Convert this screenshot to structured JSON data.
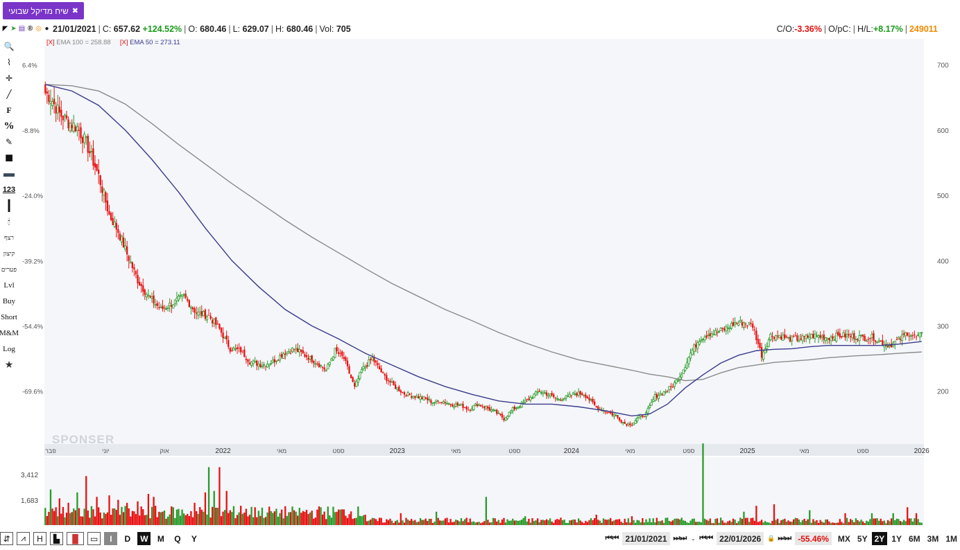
{
  "tab": {
    "label": "שיח מדיקל שבועי",
    "close": "✖"
  },
  "info": {
    "date": "21/01/2021",
    "close_label": "C:",
    "close_value": "657.62",
    "change": "+124.52%",
    "open_label": "O:",
    "open_value": "680.46",
    "low_label": "L:",
    "low_value": "629.07",
    "high_label": "H:",
    "high_value": "680.46",
    "vol_label": "Vol:",
    "vol_value": "705",
    "co_label": "C/O:",
    "co_value": "-3.36%",
    "opc_label": "O/pC:",
    "hl_label": "H/L:",
    "hl_value": "+8.17%",
    "security_id": "249011"
  },
  "legend": {
    "ema100": "EMA 100 = 258.88",
    "ema50": "EMA 50 = 273.11",
    "remove": "[X]"
  },
  "toolbar": [
    "🔍",
    "⌇",
    "✛",
    "╱",
    "F",
    "%",
    "✎",
    "■",
    "▬",
    "123",
    "┃",
    "🕯",
    "רצף",
    "קיצון",
    "פערים",
    "Lvl",
    "Buy",
    "Short",
    "M&M",
    "Log",
    "★"
  ],
  "watermark": "SPONSER",
  "colors": {
    "up": "#2a9a2a",
    "down": "#e81010",
    "ema50": "#3a3a8c",
    "ema100": "#8a8a8a"
  },
  "chart_data": {
    "type": "candlestick",
    "x_tick_labels": [
      "פבר",
      "יוני",
      "אוק",
      "2022",
      "מאי",
      "ספט",
      "2023",
      "מאי",
      "ספט",
      "2024",
      "מאי",
      "ספט",
      "2025",
      "מאי",
      "ספט",
      "2026"
    ],
    "y_right_ticks": [
      "700",
      "600",
      "500",
      "400",
      "300",
      "200"
    ],
    "y_left_ticks": [
      "6.4%",
      "-8.8%",
      "-24.0%",
      "-39.2%",
      "-54.4%",
      "-69.6%"
    ],
    "volume_ticks": [
      "3,412",
      "1,683"
    ],
    "ylim": [
      120,
      740
    ],
    "price_path": [
      [
        0,
        657
      ],
      [
        3,
        650
      ],
      [
        8,
        625
      ],
      [
        13,
        612
      ],
      [
        18,
        604
      ],
      [
        23,
        580
      ],
      [
        30,
        530
      ],
      [
        36,
        470
      ],
      [
        41,
        445
      ],
      [
        46,
        410
      ],
      [
        52,
        370
      ],
      [
        58,
        345
      ],
      [
        65,
        325
      ],
      [
        72,
        335
      ],
      [
        78,
        345
      ],
      [
        85,
        320
      ],
      [
        92,
        315
      ],
      [
        98,
        295
      ],
      [
        104,
        265
      ],
      [
        110,
        262
      ],
      [
        115,
        245
      ],
      [
        122,
        240
      ],
      [
        128,
        245
      ],
      [
        134,
        258
      ],
      [
        140,
        265
      ],
      [
        146,
        255
      ],
      [
        152,
        245
      ],
      [
        158,
        232
      ],
      [
        163,
        262
      ],
      [
        168,
        250
      ],
      [
        174,
        205
      ],
      [
        178,
        232
      ],
      [
        184,
        250
      ],
      [
        190,
        225
      ],
      [
        196,
        208
      ],
      [
        202,
        196
      ],
      [
        208,
        192
      ],
      [
        214,
        188
      ],
      [
        218,
        183
      ],
      [
        223,
        185
      ],
      [
        228,
        180
      ],
      [
        234,
        178
      ],
      [
        238,
        172
      ],
      [
        243,
        180
      ],
      [
        248,
        175
      ],
      [
        253,
        168
      ],
      [
        258,
        158
      ],
      [
        263,
        172
      ],
      [
        268,
        180
      ],
      [
        273,
        190
      ],
      [
        278,
        200
      ],
      [
        283,
        195
      ],
      [
        288,
        188
      ],
      [
        293,
        190
      ],
      [
        298,
        196
      ],
      [
        303,
        196
      ],
      [
        310,
        175
      ],
      [
        316,
        168
      ],
      [
        321,
        162
      ],
      [
        326,
        150
      ],
      [
        330,
        150
      ],
      [
        334,
        160
      ],
      [
        338,
        165
      ],
      [
        343,
        192
      ],
      [
        348,
        198
      ],
      [
        353,
        208
      ],
      [
        358,
        228
      ],
      [
        363,
        258
      ],
      [
        368,
        280
      ],
      [
        373,
        288
      ],
      [
        378,
        290
      ],
      [
        383,
        296
      ],
      [
        388,
        304
      ],
      [
        393,
        305
      ],
      [
        398,
        300
      ],
      [
        403,
        255
      ],
      [
        408,
        285
      ],
      [
        413,
        285
      ],
      [
        418,
        280
      ],
      [
        425,
        280
      ],
      [
        432,
        285
      ],
      [
        440,
        282
      ],
      [
        447,
        285
      ],
      [
        454,
        284
      ],
      [
        460,
        282
      ],
      [
        466,
        282
      ],
      [
        470,
        275
      ],
      [
        475,
        270
      ],
      [
        480,
        278
      ],
      [
        485,
        290
      ],
      [
        490,
        282
      ],
      [
        493,
        286
      ]
    ],
    "ema50_path": [
      [
        0,
        670
      ],
      [
        15,
        660
      ],
      [
        30,
        638
      ],
      [
        45,
        600
      ],
      [
        60,
        555
      ],
      [
        75,
        505
      ],
      [
        90,
        450
      ],
      [
        105,
        400
      ],
      [
        120,
        360
      ],
      [
        135,
        325
      ],
      [
        150,
        300
      ],
      [
        165,
        280
      ],
      [
        180,
        258
      ],
      [
        195,
        240
      ],
      [
        210,
        222
      ],
      [
        225,
        207
      ],
      [
        240,
        195
      ],
      [
        255,
        185
      ],
      [
        270,
        180
      ],
      [
        285,
        180
      ],
      [
        300,
        176
      ],
      [
        315,
        170
      ],
      [
        330,
        162
      ],
      [
        340,
        165
      ],
      [
        350,
        180
      ],
      [
        360,
        205
      ],
      [
        370,
        225
      ],
      [
        380,
        243
      ],
      [
        390,
        255
      ],
      [
        400,
        262
      ],
      [
        410,
        264
      ],
      [
        420,
        265
      ],
      [
        430,
        268
      ],
      [
        440,
        270
      ],
      [
        455,
        270
      ],
      [
        470,
        270
      ],
      [
        480,
        272
      ],
      [
        493,
        276
      ]
    ],
    "ema100_path": [
      [
        0,
        670
      ],
      [
        15,
        668
      ],
      [
        30,
        660
      ],
      [
        45,
        640
      ],
      [
        60,
        610
      ],
      [
        75,
        578
      ],
      [
        90,
        548
      ],
      [
        105,
        518
      ],
      [
        120,
        490
      ],
      [
        135,
        462
      ],
      [
        150,
        436
      ],
      [
        165,
        412
      ],
      [
        180,
        388
      ],
      [
        195,
        365
      ],
      [
        210,
        345
      ],
      [
        225,
        325
      ],
      [
        240,
        308
      ],
      [
        255,
        290
      ],
      [
        270,
        274
      ],
      [
        285,
        260
      ],
      [
        300,
        248
      ],
      [
        315,
        240
      ],
      [
        330,
        232
      ],
      [
        340,
        226
      ],
      [
        350,
        222
      ],
      [
        360,
        216
      ],
      [
        370,
        218
      ],
      [
        380,
        228
      ],
      [
        390,
        236
      ],
      [
        400,
        240
      ],
      [
        410,
        244
      ],
      [
        420,
        246
      ],
      [
        430,
        248
      ],
      [
        440,
        251
      ],
      [
        455,
        254
      ],
      [
        470,
        256
      ],
      [
        480,
        258
      ],
      [
        493,
        260
      ]
    ],
    "volume_spikes": [
      [
        3,
        2400
      ],
      [
        8,
        1800
      ],
      [
        13,
        1500
      ],
      [
        18,
        2200
      ],
      [
        23,
        3300
      ],
      [
        29,
        1900
      ],
      [
        36,
        2000
      ],
      [
        41,
        1700
      ],
      [
        46,
        1500
      ],
      [
        52,
        1600
      ],
      [
        58,
        2100
      ],
      [
        61,
        1900
      ],
      [
        66,
        900
      ],
      [
        72,
        1200
      ],
      [
        84,
        1500
      ],
      [
        90,
        2200
      ],
      [
        92,
        3900
      ],
      [
        95,
        2300
      ],
      [
        98,
        3900
      ],
      [
        102,
        2300
      ],
      [
        110,
        1300
      ],
      [
        118,
        1200
      ],
      [
        130,
        1100
      ],
      [
        140,
        1000
      ],
      [
        155,
        1200
      ],
      [
        180,
        700
      ],
      [
        200,
        800
      ],
      [
        220,
        900
      ],
      [
        248,
        1900
      ],
      [
        270,
        600
      ],
      [
        290,
        500
      ],
      [
        310,
        700
      ],
      [
        330,
        600
      ],
      [
        350,
        500
      ],
      [
        370,
        5500
      ],
      [
        380,
        500
      ],
      [
        393,
        900
      ],
      [
        400,
        1300
      ],
      [
        410,
        1400
      ],
      [
        430,
        1000
      ],
      [
        450,
        800
      ],
      [
        465,
        800
      ],
      [
        477,
        800
      ],
      [
        485,
        1200
      ],
      [
        490,
        800
      ]
    ]
  },
  "bottom": {
    "tools": [
      "⇵",
      "⩘",
      "H",
      "▙",
      "▐▌",
      "▭",
      "I"
    ],
    "intervals": [
      "D",
      "W",
      "M",
      "Q",
      "Y"
    ],
    "active_interval": "W",
    "from_date": "21/01/2021",
    "dash": "-",
    "to_date": "22/01/2026",
    "range_change": "-55.46%",
    "ranges": [
      "MX",
      "5Y",
      "2Y",
      "1Y",
      "6M",
      "3M",
      "1M"
    ],
    "active_range": "2Y",
    "nav_back": "⏮⏮",
    "nav_fwd": "⏭⏭",
    "lock": "🔒"
  }
}
